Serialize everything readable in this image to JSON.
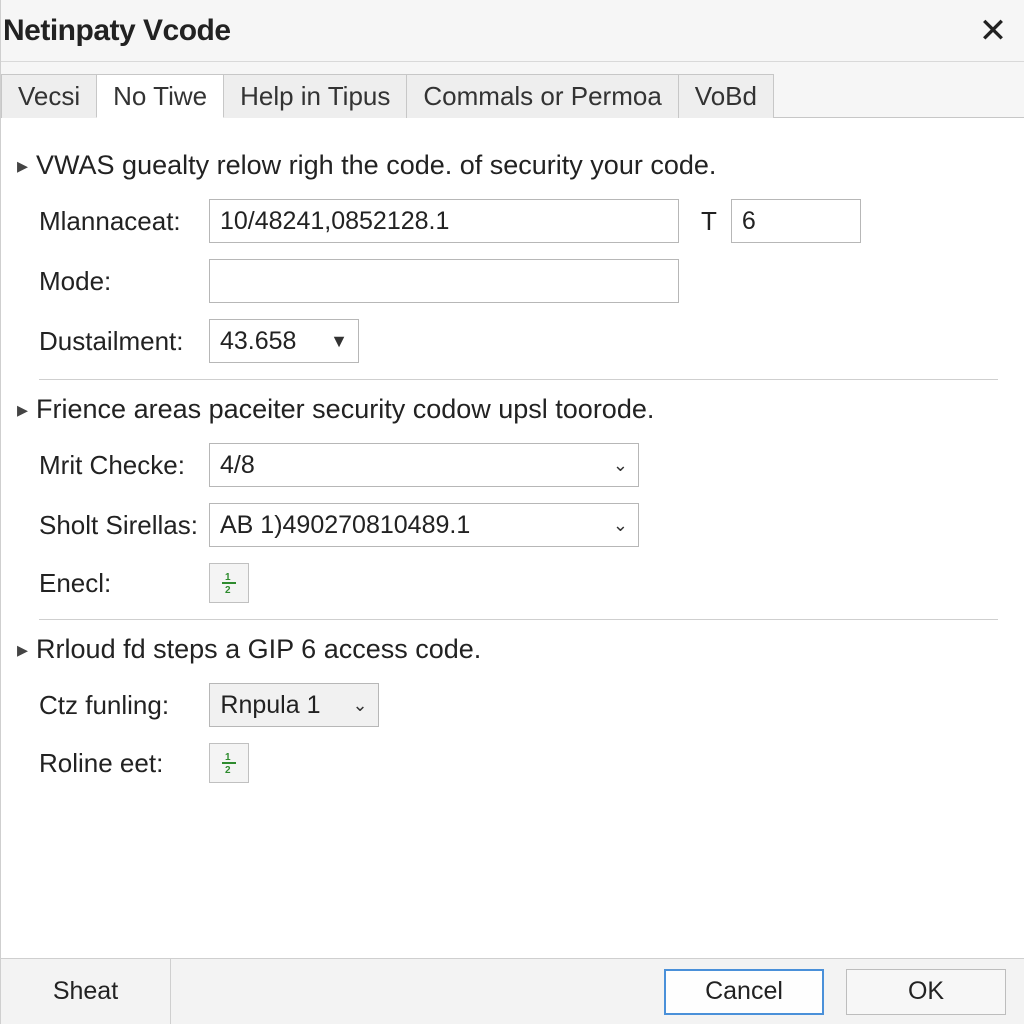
{
  "window": {
    "title": "Netinpaty Vcode"
  },
  "tabs": {
    "t0": "Vecsi",
    "t1": "No Tiwe",
    "t2": "Help in Tipus",
    "t3": "Commals or Permoa",
    "t4": "VoBd"
  },
  "section1": {
    "heading": "VWAS guealty relow righ the code. of security your code.",
    "mlannaceat_label": "Mlannaceat:",
    "mlannaceat_value": "10/48241,0852128.1",
    "t_label": "T",
    "t_value": "6",
    "mode_label": "Mode:",
    "mode_value": "",
    "dustailment_label": "Dustailment:",
    "dustailment_value": "43.658"
  },
  "section2": {
    "heading": "Frience areas paceiter security codow upsl toorode.",
    "mrit_label": "Mrit Checke:",
    "mrit_value": "4/8",
    "sholt_label": "Sholt Sirellas:",
    "sholt_value": "AB 1)490270810489.1",
    "enecl_label": "Enecl:"
  },
  "section3": {
    "heading": "Rrloud fd steps a GIP 6 access code.",
    "ctz_label": "Ctz funling:",
    "ctz_value": "Rnpula 1",
    "roline_label": "Roline eet:"
  },
  "footer": {
    "sheat": "Sheat",
    "cancel": "Cancel",
    "ok": "OK"
  }
}
